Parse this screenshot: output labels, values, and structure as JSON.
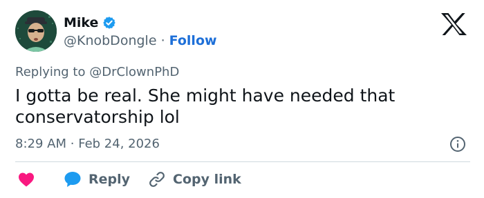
{
  "user": {
    "name": "Mike",
    "handle": "@KnobDongle",
    "separator": "·",
    "follow_label": "Follow"
  },
  "tweet": {
    "replying_prefix": "Replying to",
    "replying_handle": "@DrClownPhD",
    "text": "I gotta be real. She might have needed that conservatorship lol",
    "time": "8:29 AM",
    "time_separator": "·",
    "date": "Feb 24, 2026"
  },
  "actions": {
    "reply_label": "Reply",
    "copy_label": "Copy link"
  },
  "icons": {
    "verified": "verified-badge-icon",
    "logo": "x-logo-icon",
    "info": "info-icon",
    "like": "heart-icon",
    "reply": "speech-bubble-icon",
    "copy": "link-icon"
  },
  "colors": {
    "text": "#0f1419",
    "muted": "#536471",
    "accent": "#1d9bf0",
    "follow": "#1d6fd8",
    "like": "#f91880",
    "divider": "#cfd9de"
  }
}
